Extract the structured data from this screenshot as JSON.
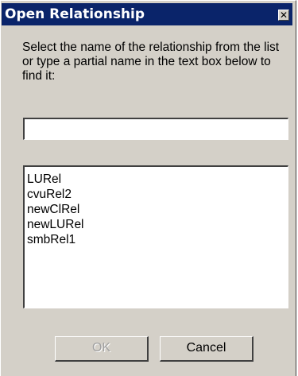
{
  "window": {
    "title": "Open Relationship",
    "close_glyph": "✕"
  },
  "instructions": "Select the name of the relationship from the list or type a partial name in the text box below to find it:",
  "search": {
    "value": "",
    "placeholder": ""
  },
  "relationships": {
    "items": [
      "LURel",
      "cvuRel2",
      "newClRel",
      "newLURel",
      "smbRel1"
    ]
  },
  "buttons": {
    "ok_label": "OK",
    "ok_enabled": false,
    "cancel_label": "Cancel"
  },
  "colors": {
    "titlebar": "#0a246a",
    "dialog_face": "#d4d0c8",
    "disabled_text": "#a0a0a0"
  }
}
